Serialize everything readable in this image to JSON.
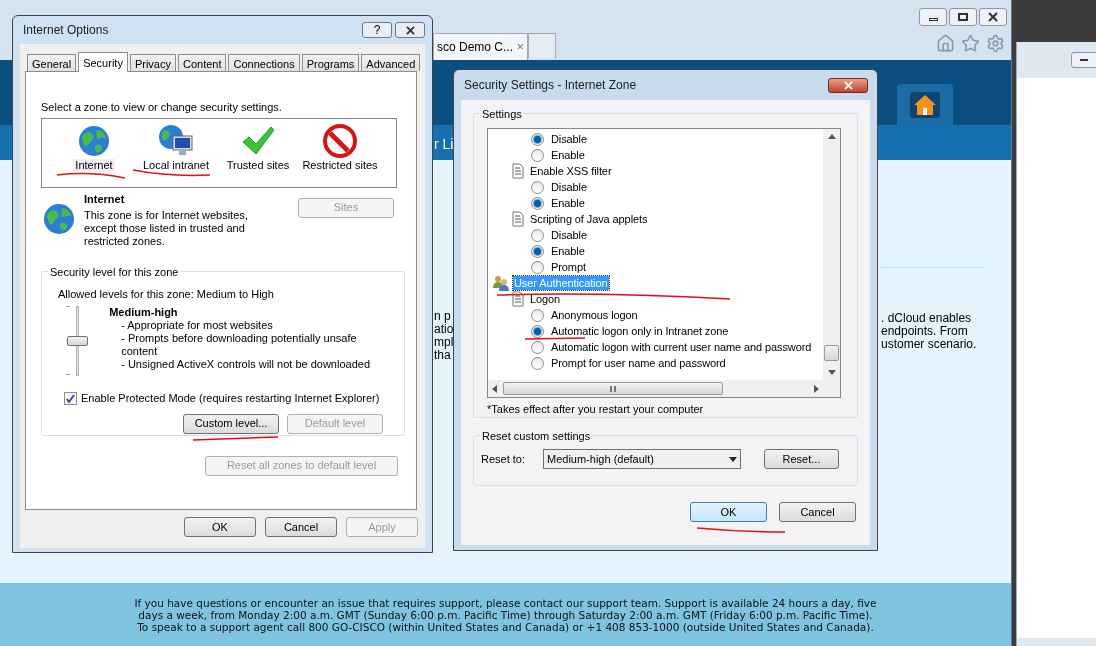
{
  "browser": {
    "tab_title": "sco Demo C...",
    "tab_close": "×",
    "nav_fragment": "r Li",
    "body_fragments_left": [
      "n p",
      "atio",
      "mpl",
      "tha"
    ],
    "body_fragments_right": [
      ". dCloud enables",
      "endpoints. From",
      "ustomer scenario."
    ],
    "footer": [
      "If you have questions or encounter an issue that requires support, please contact our support team. Support is available 24 hours a day, five",
      "days a week, from Monday 2:00 a.m. GMT (Sunday 6:00 p.m. Pacific Time) through Saturday 2:00 a.m. GMT (Friday 6:00 p.m. Pacific Time).",
      "To speak to a support agent call 800 GO-CISCO (within United States and Canada) or +1 408 853-1000 (outside United States and Canada)."
    ]
  },
  "internet_options": {
    "title": "Internet Options",
    "help": "?",
    "tabs": [
      {
        "label": "General",
        "selected": false
      },
      {
        "label": "Security",
        "selected": true
      },
      {
        "label": "Privacy",
        "selected": false
      },
      {
        "label": "Content",
        "selected": false
      },
      {
        "label": "Connections",
        "selected": false
      },
      {
        "label": "Programs",
        "selected": false
      },
      {
        "label": "Advanced",
        "selected": false
      }
    ],
    "zone_prompt": "Select a zone to view or change security settings.",
    "zones": [
      {
        "label": "Internet",
        "kind": "globe",
        "selected": true
      },
      {
        "label": "Local intranet",
        "kind": "intranet",
        "selected": false
      },
      {
        "label": "Trusted sites",
        "kind": "trusted",
        "selected": false
      },
      {
        "label": "Restricted sites",
        "kind": "restricted",
        "selected": false
      }
    ],
    "zone_name": "Internet",
    "zone_description": "This zone is for Internet websites, except those listed in trusted and restricted zones.",
    "sites_button": {
      "label": "Sites",
      "disabled": true
    },
    "level_group": {
      "legend": "Security level for this zone",
      "allowed": "Allowed levels for this zone: Medium to High",
      "slider": {
        "level": 0.5
      },
      "level_name": "Medium-high",
      "bullets": [
        "- Appropriate for most websites",
        "- Prompts before downloading potentially unsafe content",
        "- Unsigned ActiveX controls will not be downloaded"
      ],
      "protected_mode": {
        "label": "Enable Protected Mode (requires restarting Internet Explorer)",
        "checked": true
      },
      "buttons": [
        {
          "label": "Custom level...",
          "disabled": false
        },
        {
          "label": "Default level",
          "disabled": true
        }
      ]
    },
    "reset_all": {
      "label": "Reset all zones to default level",
      "disabled": true
    },
    "footer_buttons": [
      {
        "label": "OK",
        "disabled": false
      },
      {
        "label": "Cancel",
        "disabled": false
      },
      {
        "label": "Apply",
        "disabled": true
      }
    ]
  },
  "security_settings": {
    "title": "Security Settings - Internet Zone",
    "settings_legend": "Settings",
    "tree": [
      {
        "kind": "category",
        "children": [
          {
            "kind": "setting",
            "children": [
              {
                "kind": "option",
                "label": "Disable",
                "checked": true
              },
              {
                "kind": "option",
                "label": "Enable",
                "checked": false
              }
            ]
          },
          {
            "kind": "setting",
            "label": "Enable XSS filter",
            "selected": false,
            "children": [
              {
                "kind": "option",
                "label": "Disable",
                "checked": false
              },
              {
                "kind": "option",
                "label": "Enable",
                "checked": true
              }
            ]
          },
          {
            "kind": "setting",
            "label": "Scripting of Java applets",
            "selected": false,
            "children": [
              {
                "kind": "option",
                "label": "Disable",
                "checked": false
              },
              {
                "kind": "option",
                "label": "Enable",
                "checked": true
              },
              {
                "kind": "option",
                "label": "Prompt",
                "checked": false
              }
            ]
          }
        ]
      },
      {
        "kind": "category",
        "label": "User Authentication",
        "selected": true,
        "children": [
          {
            "kind": "setting",
            "label": "Logon",
            "selected": false,
            "children": [
              {
                "kind": "option",
                "label": "Anonymous logon",
                "checked": false
              },
              {
                "kind": "option",
                "label": "Automatic logon only in Intranet zone",
                "checked": true
              },
              {
                "kind": "option",
                "label": "Automatic logon with current user name and password",
                "checked": false
              },
              {
                "kind": "option",
                "label": "Prompt for user name and password",
                "checked": false
              }
            ]
          }
        ]
      }
    ],
    "note": "*Takes effect after you restart your computer",
    "reset_group": {
      "legend": "Reset custom settings",
      "label": "Reset to:",
      "dropdown": "Medium-high (default)",
      "button": "Reset..."
    },
    "buttons": [
      {
        "label": "OK",
        "focused": true
      },
      {
        "label": "Cancel",
        "focused": false
      }
    ]
  }
}
